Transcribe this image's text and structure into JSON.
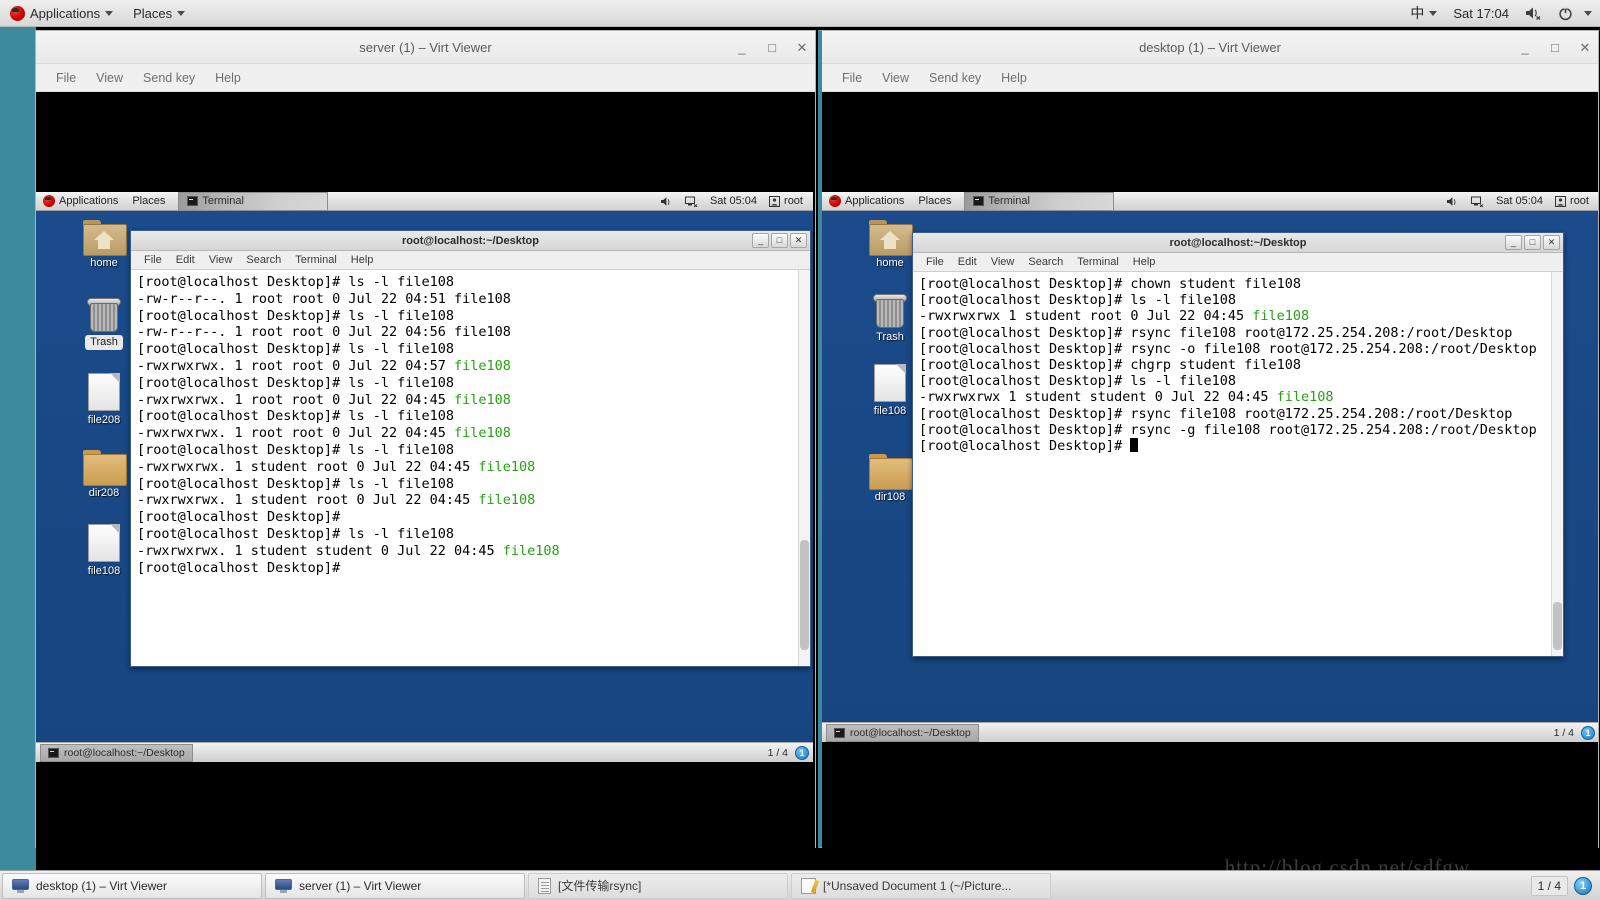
{
  "host_panel": {
    "applications_label": "Applications",
    "places_label": "Places",
    "ime_label": "中",
    "clock": "Sat 17:04",
    "speaker_icon": "speaker-muted-icon",
    "power_icon": "power-icon"
  },
  "windows": [
    {
      "title": "server (1) – Virt Viewer",
      "menu": [
        "File",
        "View",
        "Send key",
        "Help"
      ],
      "buttons": {
        "minimize": "_",
        "maximize": "□",
        "close": "✕"
      },
      "guest": {
        "panel": {
          "applications_label": "Applications",
          "places_label": "Places",
          "window_task": "Terminal",
          "clock": "Sat 05:04",
          "user": "root"
        },
        "desktop_icons": [
          {
            "name": "home",
            "type": "home-folder",
            "selected": false
          },
          {
            "name": "Trash",
            "type": "trash",
            "selected": true
          },
          {
            "name": "file208",
            "type": "file",
            "selected": false
          },
          {
            "name": "dir208",
            "type": "folder",
            "selected": false
          },
          {
            "name": "file108",
            "type": "file",
            "selected": false
          }
        ],
        "terminal": {
          "title": "root@localhost:~/Desktop",
          "menu": [
            "File",
            "Edit",
            "View",
            "Search",
            "Terminal",
            "Help"
          ],
          "buttons": {
            "minimize": "_",
            "maximize": "□",
            "close": "✕"
          },
          "lines": [
            {
              "text": "[root@localhost Desktop]# ls -l file108"
            },
            {
              "text": "-rw-r--r--. 1 root root 0 Jul 22 04:51 file108"
            },
            {
              "text": "[root@localhost Desktop]# ls -l file108"
            },
            {
              "text": "-rw-r--r--. 1 root root 0 Jul 22 04:56 file108"
            },
            {
              "text": "[root@localhost Desktop]# ls -l file108"
            },
            {
              "text": "-rwxrwxrwx. 1 root root 0 Jul 22 04:57 ",
              "green": "file108"
            },
            {
              "text": "[root@localhost Desktop]# ls -l file108"
            },
            {
              "text": "-rwxrwxrwx. 1 root root 0 Jul 22 04:45 ",
              "green": "file108"
            },
            {
              "text": "[root@localhost Desktop]# ls -l file108"
            },
            {
              "text": "-rwxrwxrwx. 1 root root 0 Jul 22 04:45 ",
              "green": "file108"
            },
            {
              "text": "[root@localhost Desktop]# ls -l file108"
            },
            {
              "text": "-rwxrwxrwx. 1 student root 0 Jul 22 04:45 ",
              "green": "file108"
            },
            {
              "text": "[root@localhost Desktop]# ls -l file108"
            },
            {
              "text": "-rwxrwxrwx. 1 student root 0 Jul 22 04:45 ",
              "green": "file108"
            },
            {
              "text": "[root@localhost Desktop]#"
            },
            {
              "text": "[root@localhost Desktop]# ls -l file108"
            },
            {
              "text": "-rwxrwxrwx. 1 student student 0 Jul 22 04:45 ",
              "green": "file108"
            },
            {
              "text": "[root@localhost Desktop]#"
            }
          ]
        },
        "bottom_panel": {
          "task": "root@localhost:~/Desktop",
          "workspace": "1 / 4",
          "badge": "1"
        }
      }
    },
    {
      "title": "desktop (1) – Virt Viewer",
      "menu": [
        "File",
        "View",
        "Send key",
        "Help"
      ],
      "buttons": {
        "minimize": "_",
        "maximize": "□",
        "close": "✕"
      },
      "guest": {
        "panel": {
          "applications_label": "Applications",
          "places_label": "Places",
          "window_task": "Terminal",
          "clock": "Sat 05:04",
          "user": "root"
        },
        "desktop_icons": [
          {
            "name": "home",
            "type": "home-folder",
            "selected": false
          },
          {
            "name": "Trash",
            "type": "trash",
            "selected": false
          },
          {
            "name": "file108",
            "type": "file",
            "selected": false
          },
          {
            "name": "dir108",
            "type": "folder",
            "selected": false
          }
        ],
        "terminal": {
          "title": "root@localhost:~/Desktop",
          "menu": [
            "File",
            "Edit",
            "View",
            "Search",
            "Terminal",
            "Help"
          ],
          "buttons": {
            "minimize": "_",
            "maximize": "□",
            "close": "✕"
          },
          "lines": [
            {
              "text": "[root@localhost Desktop]# chown student file108"
            },
            {
              "text": "[root@localhost Desktop]# ls -l file108"
            },
            {
              "text": "-rwxrwxrwx 1 student root 0 Jul 22 04:45 ",
              "green": "file108"
            },
            {
              "text": "[root@localhost Desktop]# rsync file108 root@172.25.254.208:/root/Desktop"
            },
            {
              "text": "[root@localhost Desktop]# rsync -o file108 root@172.25.254.208:/root/Desktop"
            },
            {
              "text": "[root@localhost Desktop]# chgrp student file108"
            },
            {
              "text": "[root@localhost Desktop]# ls -l file108"
            },
            {
              "text": "-rwxrwxrwx 1 student student 0 Jul 22 04:45 ",
              "green": "file108"
            },
            {
              "text": "[root@localhost Desktop]# rsync file108 root@172.25.254.208:/root/Desktop"
            },
            {
              "text": "[root@localhost Desktop]# rsync -g file108 root@172.25.254.208:/root/Desktop"
            },
            {
              "text": "[root@localhost Desktop]# ",
              "cursor": true
            }
          ]
        },
        "bottom_panel": {
          "task": "root@localhost:~/Desktop",
          "workspace": "1 / 4",
          "badge": "1"
        }
      }
    }
  ],
  "taskbar": {
    "items": [
      {
        "label": "desktop (1) – Virt Viewer",
        "icon": "monitor-icon",
        "active": true
      },
      {
        "label": "server (1) – Virt Viewer",
        "icon": "monitor-icon",
        "active": true
      },
      {
        "label": "[文件传输rsync]",
        "icon": "document-icon",
        "active": false
      },
      {
        "label": "[*Unsaved Document 1 (~/Picture...",
        "icon": "text-editor-icon",
        "active": false
      }
    ],
    "workspace": "1 / 4",
    "badge": "1"
  },
  "watermark": "http://blog.csdn.net/sdfgw"
}
